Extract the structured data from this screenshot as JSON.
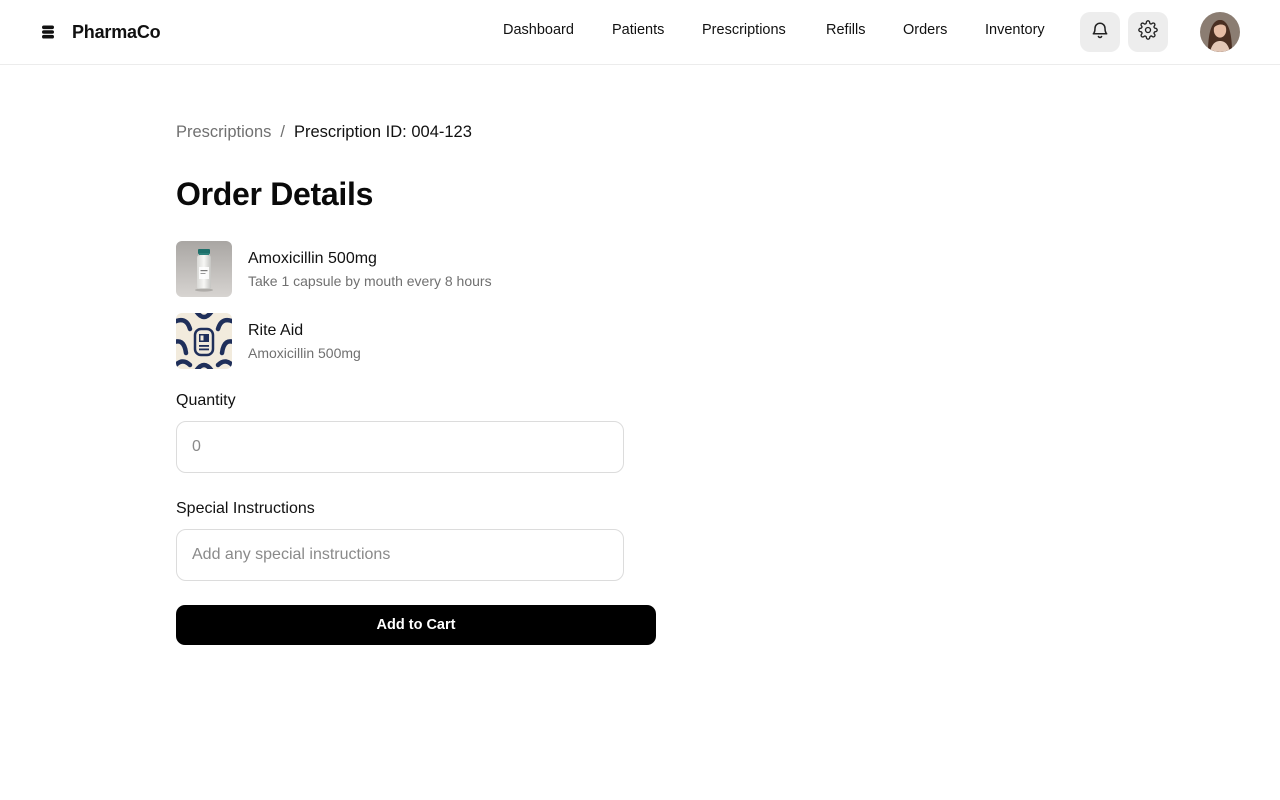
{
  "header": {
    "brand_name": "PharmaCo",
    "brand_icon": "stacked-layers-icon",
    "nav": [
      {
        "label": "Dashboard"
      },
      {
        "label": "Patients"
      },
      {
        "label": "Prescriptions"
      },
      {
        "label": "Refills"
      },
      {
        "label": "Orders"
      },
      {
        "label": "Inventory"
      }
    ],
    "notifications_icon": "bell-icon",
    "settings_icon": "gear-icon",
    "avatar_icon": "user-avatar"
  },
  "breadcrumb": {
    "parent": "Prescriptions",
    "separator": "/",
    "current": "Prescription ID: 004-123"
  },
  "page": {
    "title": "Order Details"
  },
  "items": [
    {
      "title": "Amoxicillin 500mg",
      "subtitle": "Take 1 capsule by mouth every 8 hours",
      "thumb_icon": "medicine-bottle-image"
    },
    {
      "title": "Rite Aid",
      "subtitle": "Amoxicillin 500mg",
      "thumb_icon": "pharmacy-pattern-logo"
    }
  ],
  "form": {
    "quantity_label": "Quantity",
    "quantity_placeholder": "0",
    "quantity_value": "",
    "instructions_label": "Special Instructions",
    "instructions_placeholder": "Add any special instructions",
    "instructions_value": "",
    "submit_label": "Add to Cart"
  },
  "colors": {
    "primary_button": "#000000",
    "muted_text": "#707070",
    "icon_button_bg": "#ededed",
    "border": "#dcdcdc"
  }
}
